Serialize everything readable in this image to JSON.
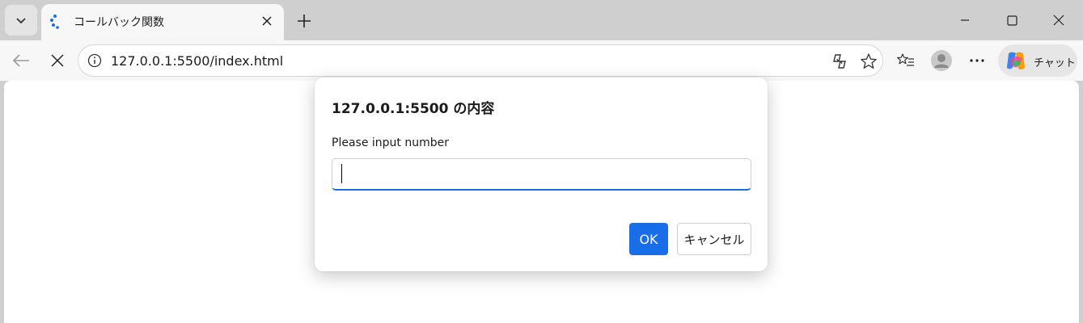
{
  "colors": {
    "accent": "#1a6de8",
    "tab_active": "#f7f7f7",
    "tabstrip": "#cfcfcf",
    "spinner": "#1a6de8"
  },
  "tab": {
    "title": "コールバック関数",
    "favicon": "loading-spinner-icon",
    "close_icon": "close-icon"
  },
  "tabstrip": {
    "menu_icon": "chevron-down-icon",
    "new_tab_icon": "plus-icon"
  },
  "window": {
    "minimize_icon": "minimize-icon",
    "maximize_icon": "maximize-icon",
    "close_icon": "close-icon"
  },
  "toolbar": {
    "back_icon": "back-arrow-icon",
    "stop_icon": "stop-loading-icon",
    "site_info_icon": "info-icon",
    "url": "127.0.0.1:5500/index.html",
    "copilot_icon": "copilot-icon",
    "favorite_icon": "star-icon",
    "favorites_icon": "favorites-list-icon",
    "profile_icon": "profile-avatar-icon",
    "more_icon": "more-dots-icon",
    "chat_label": "チャット"
  },
  "dialog": {
    "title": "127.0.0.1:5500 の内容",
    "message": "Please input number",
    "input_value": "",
    "ok_label": "OK",
    "cancel_label": "キャンセル"
  }
}
